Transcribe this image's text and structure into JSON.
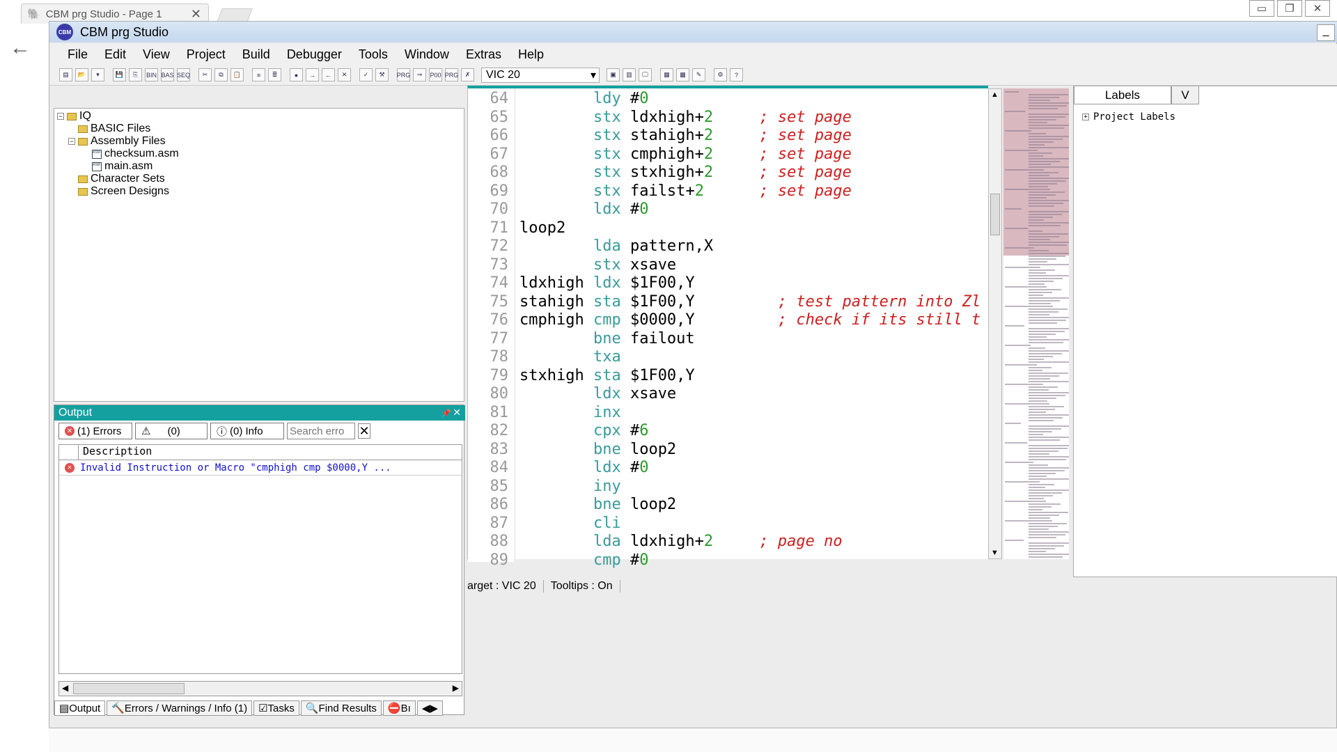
{
  "browser": {
    "tab_title": "CBM prg Studio - Page 1"
  },
  "app": {
    "title": "CBM prg Studio"
  },
  "menu": [
    "File",
    "Edit",
    "View",
    "Project",
    "Build",
    "Debugger",
    "Tools",
    "Window",
    "Extras",
    "Help"
  ],
  "toolbar": {
    "target": "VIC 20",
    "icons": [
      "new-project",
      "open",
      "dropdown",
      "save",
      "save-all",
      "bin",
      "bas",
      "seq",
      "cut",
      "copy",
      "paste",
      "indent",
      "outdent",
      "bookmark",
      "next",
      "prev",
      "close",
      "check",
      "build",
      "prg",
      "prg-run",
      "p00",
      "prg2",
      "debug",
      "grid",
      "chart",
      "sprite",
      "edit",
      "gear",
      "help"
    ]
  },
  "explorer": {
    "root": "IQ",
    "items": [
      {
        "label": "BASIC Files",
        "type": "folder",
        "level": 1
      },
      {
        "label": "Assembly Files",
        "type": "folder",
        "level": 1
      },
      {
        "label": "checksum.asm",
        "type": "file",
        "level": 2
      },
      {
        "label": "main.asm",
        "type": "file",
        "level": 2
      },
      {
        "label": "Character Sets",
        "type": "folder",
        "level": 1
      },
      {
        "label": "Screen Designs",
        "type": "folder",
        "level": 1
      }
    ]
  },
  "output": {
    "title": "Output",
    "errors_btn": "(1) Errors",
    "warnings_btn": "(0)",
    "info_btn": "(0) Info",
    "search_placeholder": "Search erro",
    "header": "Description",
    "error_row": "Invalid Instruction or Macro \"cmphigh cmp $0000,Y ...",
    "tabs": [
      "Output",
      "Errors / Warnings / Info (1)",
      "Tasks",
      "Find Results",
      "Bı"
    ]
  },
  "editor": {
    "lines": [
      {
        "n": "64",
        "label": "",
        "op": "ldy",
        "arg": "#0",
        "comment": ""
      },
      {
        "n": "65",
        "label": "",
        "op": "stx",
        "arg": "ldxhigh+2",
        "comment": "; set page"
      },
      {
        "n": "66",
        "label": "",
        "op": "stx",
        "arg": "stahigh+2",
        "comment": "; set page"
      },
      {
        "n": "67",
        "label": "",
        "op": "stx",
        "arg": "cmphigh+2",
        "comment": "; set page"
      },
      {
        "n": "68",
        "label": "",
        "op": "stx",
        "arg": "stxhigh+2",
        "comment": "; set page"
      },
      {
        "n": "69",
        "label": "",
        "op": "stx",
        "arg": "failst+2",
        "comment": "; set page"
      },
      {
        "n": "70",
        "label": "",
        "op": "ldx",
        "arg": "#0",
        "comment": ""
      },
      {
        "n": "71",
        "label": "loop2",
        "op": "",
        "arg": "",
        "comment": ""
      },
      {
        "n": "72",
        "label": "",
        "op": "lda",
        "arg": "pattern,X",
        "comment": ""
      },
      {
        "n": "73",
        "label": "",
        "op": "stx",
        "arg": "xsave",
        "comment": ""
      },
      {
        "n": "74",
        "label": "ldxhigh",
        "op": "ldx",
        "arg": "$1F00,Y",
        "comment": ""
      },
      {
        "n": "75",
        "label": "stahigh",
        "op": "sta",
        "arg": "$1F00,Y",
        "comment": "; test pattern into Zl"
      },
      {
        "n": "76",
        "label": "cmphigh",
        "op": "cmp",
        "arg": "$0000,Y",
        "comment": "; check if its still t"
      },
      {
        "n": "77",
        "label": "",
        "op": "bne",
        "arg": "failout",
        "comment": ""
      },
      {
        "n": "78",
        "label": "",
        "op": "txa",
        "arg": "",
        "comment": ""
      },
      {
        "n": "79",
        "label": "stxhigh",
        "op": "sta",
        "arg": "$1F00,Y",
        "comment": ""
      },
      {
        "n": "80",
        "label": "",
        "op": "ldx",
        "arg": "xsave",
        "comment": ""
      },
      {
        "n": "81",
        "label": "",
        "op": "inx",
        "arg": "",
        "comment": ""
      },
      {
        "n": "82",
        "label": "",
        "op": "cpx",
        "arg": "#6",
        "comment": ""
      },
      {
        "n": "83",
        "label": "",
        "op": "bne",
        "arg": "loop2",
        "comment": ""
      },
      {
        "n": "84",
        "label": "",
        "op": "ldx",
        "arg": "#0",
        "comment": ""
      },
      {
        "n": "85",
        "label": "",
        "op": "iny",
        "arg": "",
        "comment": ""
      },
      {
        "n": "86",
        "label": "",
        "op": "bne",
        "arg": "loop2",
        "comment": ""
      },
      {
        "n": "87",
        "label": "",
        "op": "cli",
        "arg": "",
        "comment": ""
      },
      {
        "n": "88",
        "label": "",
        "op": "lda",
        "arg": "ldxhigh+2",
        "comment": "; page no"
      },
      {
        "n": "89",
        "label": "",
        "op": "cmp",
        "arg": "#0",
        "comment": ""
      }
    ]
  },
  "props": {
    "tab_labels": "Labels",
    "tab_other": "V",
    "project_labels": "Project Labels"
  },
  "status": {
    "target": "arget : VIC 20",
    "tooltips": "Tooltips : On"
  }
}
